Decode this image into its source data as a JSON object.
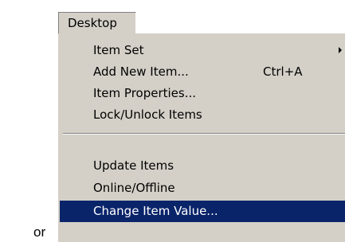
{
  "lead_text": "or",
  "menu": {
    "title": "Desktop",
    "items": [
      {
        "label": "Item Set",
        "shortcut": "",
        "submenu": true
      },
      {
        "label": "Add New Item...",
        "shortcut": "Ctrl+A",
        "submenu": false
      },
      {
        "label": "Item Properties...",
        "shortcut": "",
        "submenu": false
      },
      {
        "label": "Lock/Unlock Items",
        "shortcut": "",
        "submenu": false
      },
      {
        "label": "Update Items",
        "shortcut": "",
        "submenu": false
      },
      {
        "label": "Online/Offline",
        "shortcut": "",
        "submenu": false
      },
      {
        "label": "Change Item Value...",
        "shortcut": "",
        "submenu": false,
        "highlighted": true
      }
    ]
  },
  "colors": {
    "menu_background": "#d4d0c8",
    "highlight_background": "#0a246a",
    "highlight_text": "#ffffff",
    "text": "#000000"
  }
}
